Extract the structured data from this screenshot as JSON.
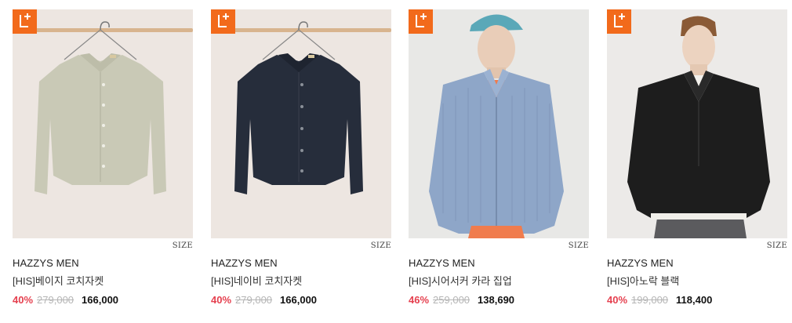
{
  "products": [
    {
      "badge_icon": "l-plus-badge-icon",
      "size_label": "SIZE",
      "brand": "HAZZYS MEN",
      "name": "[HIS]베이지 코치자켓",
      "discount": "40%",
      "original_price": "279,000",
      "sale_price": "166,000",
      "image": "beige-coach-jacket-on-hanger"
    },
    {
      "badge_icon": "l-plus-badge-icon",
      "size_label": "SIZE",
      "brand": "HAZZYS MEN",
      "name": "[HIS]네이비 코치자켓",
      "discount": "40%",
      "original_price": "279,000",
      "sale_price": "166,000",
      "image": "navy-coach-jacket-on-hanger"
    },
    {
      "badge_icon": "l-plus-badge-icon",
      "size_label": "SIZE",
      "brand": "HAZZYS MEN",
      "name": "[HIS]시어서커 카라 집업",
      "discount": "46%",
      "original_price": "259,000",
      "sale_price": "138,690",
      "image": "model-in-seersucker-zip-up"
    },
    {
      "badge_icon": "l-plus-badge-icon",
      "size_label": "SIZE",
      "brand": "HAZZYS MEN",
      "name": "[HIS]아노락 블랙",
      "discount": "40%",
      "original_price": "199,000",
      "sale_price": "118,400",
      "image": "model-in-black-anorak"
    }
  ],
  "colors": {
    "badge": "#f26a1b",
    "discount": "#e5404f",
    "original_price": "#b5b5b5"
  }
}
